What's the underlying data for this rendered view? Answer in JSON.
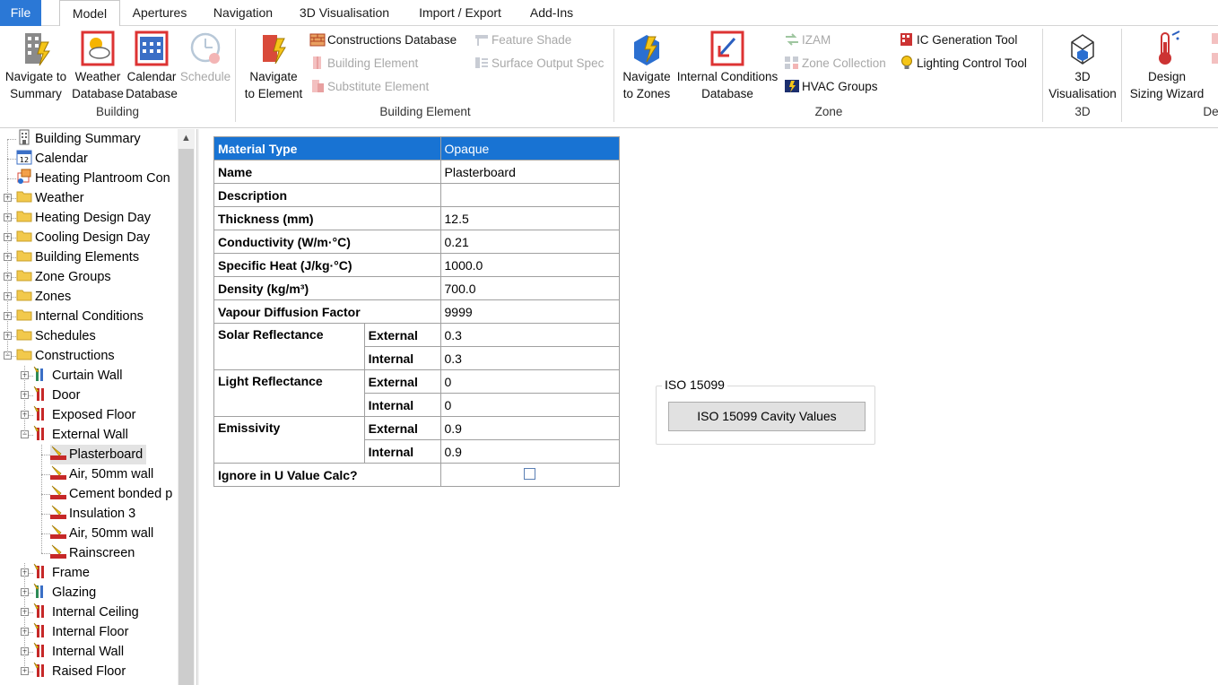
{
  "menu": {
    "tabs": [
      "File",
      "Model",
      "Apertures",
      "Navigation",
      "3D Visualisation",
      "Import / Export",
      "Add-Ins"
    ],
    "active": "Model"
  },
  "ribbon": {
    "groups": {
      "building": "Building",
      "building_element": "Building Element",
      "zone": "Zone",
      "three_d": "3D",
      "design": "De"
    },
    "navigate_summary": [
      "Navigate to",
      "Summary"
    ],
    "weather_db": [
      "Weather",
      "Database"
    ],
    "calendar_db": [
      "Calendar",
      "Database"
    ],
    "schedule": "Schedule",
    "navigate_element": [
      "Navigate",
      "to Element"
    ],
    "constructions_db": "Constructions Database",
    "building_element_btn": "Building Element",
    "substitute_element": "Substitute Element",
    "feature_shade": "Feature Shade",
    "surface_output_spec": "Surface Output Spec",
    "navigate_zones": [
      "Navigate",
      "to Zones"
    ],
    "internal_conditions_db": [
      "Internal Conditions",
      "Database"
    ],
    "izam": "IZAM",
    "zone_collection": "Zone Collection",
    "hvac_groups": "HVAC Groups",
    "ic_generation_tool": "IC Generation Tool",
    "lighting_control_tool": "Lighting Control Tool",
    "visualisation_3d": [
      "3D",
      "Visualisation"
    ],
    "design_sizing_wizard": [
      "Design",
      "Sizing Wizard"
    ]
  },
  "tree": {
    "items": [
      "Building Summary",
      "Calendar",
      "Heating Plantroom Con",
      "Weather",
      "Heating Design Day",
      "Cooling Design Day",
      "Building Elements",
      "Zone Groups",
      "Zones",
      "Internal Conditions",
      "Schedules",
      "Constructions",
      "Curtain Wall",
      "Door",
      "Exposed Floor",
      "External Wall",
      "Plasterboard",
      "Air, 50mm wall",
      "Cement bonded p",
      "Insulation 3",
      "Air, 50mm wall",
      "Rainscreen",
      "Frame",
      "Glazing",
      "Internal Ceiling",
      "Internal Floor",
      "Internal Wall",
      "Raised Floor"
    ],
    "selected": "Plasterboard"
  },
  "properties": {
    "material_type": {
      "label": "Material Type",
      "value": "Opaque"
    },
    "name": {
      "label": "Name",
      "value": "Plasterboard"
    },
    "description": {
      "label": "Description",
      "value": ""
    },
    "thickness": {
      "label": "Thickness (mm)",
      "value": "12.5"
    },
    "conductivity": {
      "label": "Conductivity (W/m·°C)",
      "value": "0.21"
    },
    "specific_heat": {
      "label": "Specific Heat (J/kg·°C)",
      "value": "1000.0"
    },
    "density": {
      "label": "Density (kg/m³)",
      "value": "700.0"
    },
    "vapour": {
      "label": "Vapour Diffusion Factor",
      "value": "9999"
    },
    "solar_reflectance": {
      "label": "Solar Reflectance",
      "external_label": "External",
      "external": "0.3",
      "internal_label": "Internal",
      "internal": "0.3"
    },
    "light_reflectance": {
      "label": "Light Reflectance",
      "external_label": "External",
      "external": "0",
      "internal_label": "Internal",
      "internal": "0"
    },
    "emissivity": {
      "label": "Emissivity",
      "external_label": "External",
      "external": "0.9",
      "internal_label": "Internal",
      "internal": "0.9"
    },
    "ignore_u": {
      "label": "Ignore in U Value Calc?",
      "checked": false
    }
  },
  "iso": {
    "legend": "ISO 15099",
    "button": "ISO 15099 Cavity Values"
  },
  "colors": {
    "file_tab": "#2b78d6",
    "grid_header": "#1873d3",
    "folder": "#f2c94c"
  }
}
